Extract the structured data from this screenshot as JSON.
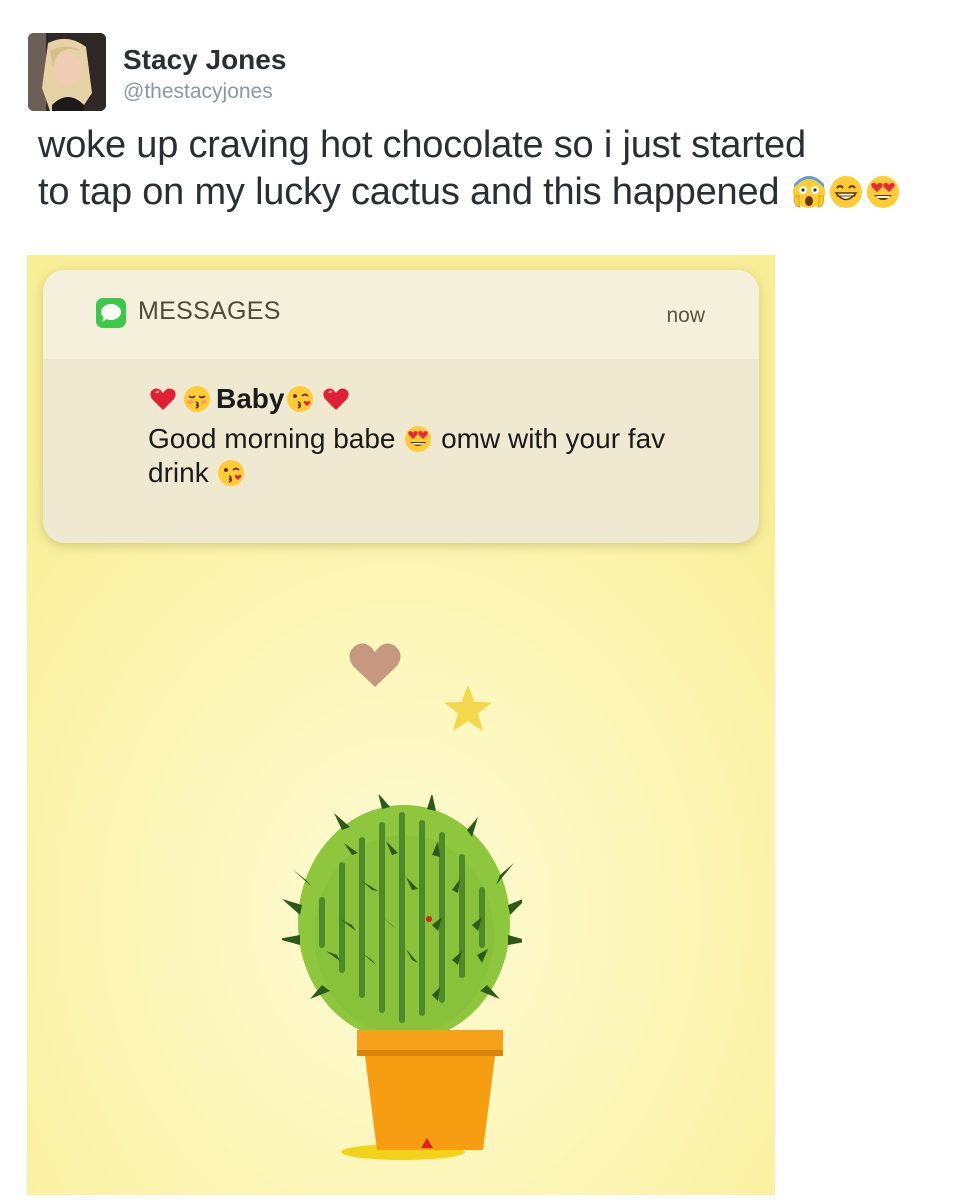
{
  "tweet": {
    "author_name": "Stacy Jones",
    "author_handle": "@thestacyjones",
    "text_line1": "woke up craving hot chocolate so i just started",
    "text_line2": "to tap on my lucky cactus and this happened",
    "text_emojis": [
      "scream-icon",
      "grin-icon",
      "heart-eyes-icon"
    ]
  },
  "notification": {
    "app_name": "MESSAGES",
    "time": "now",
    "sender_name": "Baby",
    "sender_emojis_before": [
      "red-heart-icon",
      "kissing-icon"
    ],
    "sender_emojis_after": [
      "kiss-wink-icon",
      "red-heart-icon"
    ],
    "message_part1": "Good morning babe",
    "message_part2": "omw with your fav drink"
  },
  "game": {
    "floating_items": [
      "heart-icon",
      "star-icon"
    ],
    "center_object": "cactus-icon"
  },
  "colors": {
    "background": "#fcf5b4",
    "messages_green": "#3cc94a",
    "pot_orange": "#f7a11a",
    "cactus_green": "#88c43a"
  }
}
